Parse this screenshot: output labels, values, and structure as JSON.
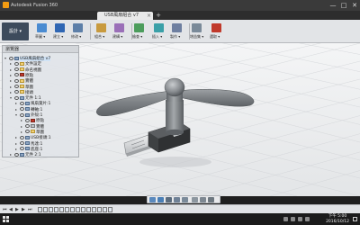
{
  "window": {
    "title": "Autodesk Fusion 360",
    "minimize_glyph": "—",
    "maximize_glyph": "□",
    "close_glyph": "✕"
  },
  "tabs": [
    {
      "label": "USB風扇組合 v7",
      "close": "×"
    }
  ],
  "new_tab_glyph": "+",
  "toolbar": {
    "workspace": "設計 ▾",
    "groups": [
      {
        "label": "草圖 ▾",
        "color": "#4a8bd1"
      },
      {
        "label": "建立 ▾",
        "color": "#2f66b3"
      },
      {
        "label": "修改 ▾",
        "color": "#5d7fa8"
      },
      {
        "label": "組合 ▾",
        "color": "#c89a3e"
      },
      {
        "label": "建構 ▾",
        "color": "#9a6fb8"
      },
      {
        "label": "檢查 ▾",
        "color": "#4b9c5c"
      },
      {
        "label": "插入 ▾",
        "color": "#3aa0a8"
      },
      {
        "label": "製作 ▾",
        "color": "#6e7fa0"
      },
      {
        "label": "增益集 ▾",
        "color": "#7a8a99"
      },
      {
        "label": "選取 ▾",
        "color": "#c0392b"
      }
    ]
  },
  "browser": {
    "header": "瀏覽器",
    "rows": [
      {
        "indent": 0,
        "label": "USB風扇組合 v7",
        "icon": "comp",
        "tri": "▾",
        "sel": true
      },
      {
        "indent": 1,
        "label": "文件設定",
        "icon": "folder",
        "tri": "▸"
      },
      {
        "indent": 1,
        "label": "命名視圖",
        "icon": "folder",
        "tri": "▸"
      },
      {
        "indent": 1,
        "label": "原點",
        "icon": "orig",
        "tri": "▸"
      },
      {
        "indent": 1,
        "label": "實體",
        "icon": "folder",
        "tri": "▸"
      },
      {
        "indent": 1,
        "label": "草圖",
        "icon": "folder",
        "tri": "▸"
      },
      {
        "indent": 1,
        "label": "接頭",
        "icon": "folder",
        "tri": "▸"
      },
      {
        "indent": 1,
        "label": "元件 1:1",
        "icon": "comp",
        "tri": "▾"
      },
      {
        "indent": 2,
        "label": "風扇葉片:1",
        "icon": "comp",
        "tri": "▸"
      },
      {
        "indent": 2,
        "label": "轉軸:1",
        "icon": "comp",
        "tri": "▸"
      },
      {
        "indent": 2,
        "label": "外殼:1",
        "icon": "comp",
        "tri": "▾"
      },
      {
        "indent": 3,
        "label": "原點",
        "icon": "orig",
        "tri": "▸"
      },
      {
        "indent": 3,
        "label": "實體",
        "icon": "body",
        "tri": "▸"
      },
      {
        "indent": 3,
        "label": "草圖",
        "icon": "folder",
        "tri": "▸"
      },
      {
        "indent": 2,
        "label": "USB接頭:1",
        "icon": "comp",
        "tri": "▸"
      },
      {
        "indent": 2,
        "label": "馬達:1",
        "icon": "comp",
        "tri": "▸"
      },
      {
        "indent": 2,
        "label": "底座:1",
        "icon": "comp",
        "tri": "▸"
      },
      {
        "indent": 1,
        "label": "元件 2:1",
        "icon": "comp",
        "tri": "▸"
      }
    ]
  },
  "timeline": {
    "controls": [
      "⏮",
      "◀",
      "▶",
      "▶",
      "⏭"
    ],
    "feature_count": 14
  },
  "taskbar": {
    "time": "下午 5:00",
    "date": "2016/10/12"
  },
  "colors": {
    "accent": "#0696d7",
    "model_metal": "#85898c",
    "model_dark": "#3b3d3f"
  }
}
